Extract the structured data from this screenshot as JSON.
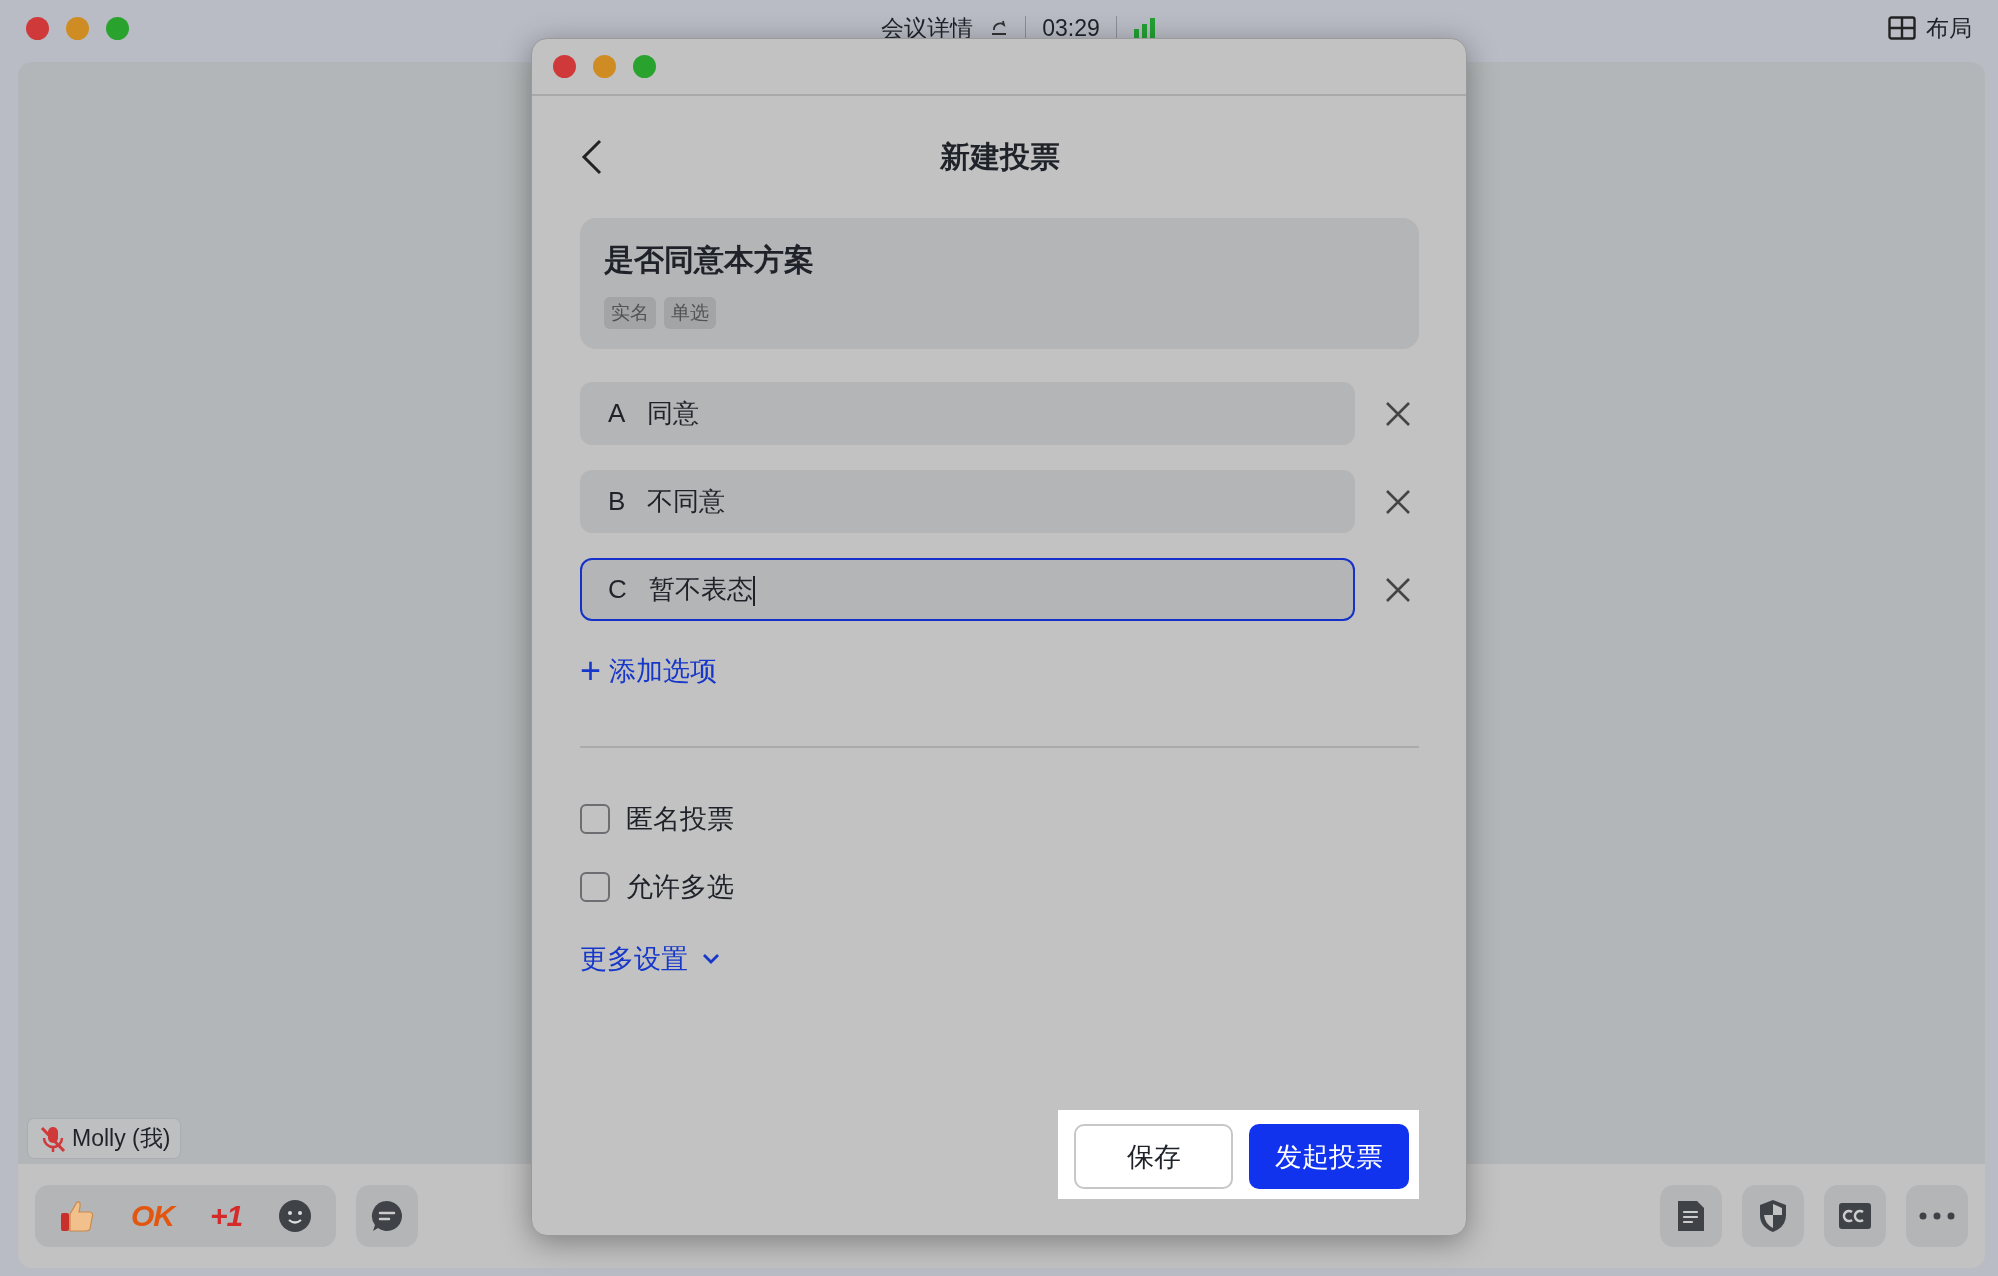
{
  "meeting": {
    "title": "会议详情",
    "timer": "03:29",
    "layout_label": "布局"
  },
  "participant": {
    "name": "Molly (我)",
    "muted": true
  },
  "reactions": [
    {
      "kind": "thumb"
    },
    {
      "kind": "text",
      "label": "OK"
    },
    {
      "kind": "text",
      "label": "+1"
    },
    {
      "kind": "smiley"
    }
  ],
  "dialog": {
    "title": "新建投票",
    "question": {
      "text": "是否同意本方案",
      "tags": [
        "实名",
        "单选"
      ]
    },
    "options": [
      {
        "letter": "A",
        "text": "同意",
        "focused": false
      },
      {
        "letter": "B",
        "text": "不同意",
        "focused": false
      },
      {
        "letter": "C",
        "text": "暂不表态",
        "focused": true
      }
    ],
    "add_option": {
      "icon": "+",
      "label": "添加选项"
    },
    "settings": [
      {
        "label": "匿名投票",
        "checked": false
      },
      {
        "label": "允许多选",
        "checked": false
      }
    ],
    "more_settings": "更多设置",
    "buttons": [
      {
        "label": "保存",
        "kind": "secondary"
      },
      {
        "label": "发起投票",
        "kind": "primary"
      }
    ]
  }
}
